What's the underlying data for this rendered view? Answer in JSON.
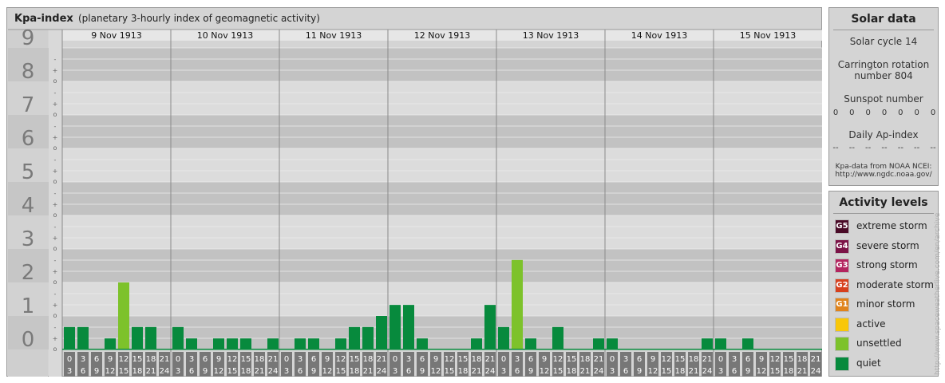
{
  "header": {
    "title": "Kpa-index",
    "subtitle": "(planetary 3-hourly index of geomagnetic activity)"
  },
  "chart_data": {
    "type": "bar",
    "title": "Kpa-index",
    "subtitle": "(planetary 3-hourly index of geomagnetic activity)",
    "ylim": [
      0,
      9
    ],
    "y_ticks": [
      "0",
      "1",
      "2",
      "3",
      "4",
      "5",
      "6",
      "7",
      "8",
      "9"
    ],
    "sub_ticks": [
      "o",
      "+",
      "-"
    ],
    "days": [
      "9 Nov 1913",
      "10 Nov 1913",
      "11 Nov 1913",
      "12 Nov 1913",
      "13 Nov 1913",
      "14 Nov 1913",
      "15 Nov 1913"
    ],
    "interval_start_hours": [
      "0",
      "3",
      "6",
      "9",
      "12",
      "15",
      "18",
      "21"
    ],
    "interval_end_hours": [
      "3",
      "6",
      "9",
      "12",
      "15",
      "18",
      "21",
      "24"
    ],
    "values": [
      0.67,
      0.67,
      0,
      0.33,
      2,
      0.67,
      0.67,
      0,
      0.67,
      0.33,
      0,
      0.33,
      0.33,
      0.33,
      0,
      0.33,
      0,
      0.33,
      0.33,
      0,
      0.33,
      0.67,
      0.67,
      1,
      1.33,
      1.33,
      0.33,
      0,
      0,
      0,
      0.33,
      1.33,
      0.67,
      2.67,
      0.33,
      0,
      0.67,
      0,
      0,
      0.33,
      0.33,
      0,
      0,
      0,
      0,
      0,
      0,
      0.33,
      0.33,
      0,
      0.33,
      0,
      0,
      0,
      0,
      0
    ],
    "colors": {
      "quiet": "#078a3d",
      "unsettled": "#7dc22b",
      "active": "#f8c70a",
      "minor": "#e0841c",
      "moderate": "#d7401e",
      "strong": "#b3255f",
      "severe": "#7c1347",
      "extreme": "#4a0b27"
    }
  },
  "solar": {
    "title": "Solar data",
    "cycle": "Solar cycle 14",
    "carrington_line1": "Carrington rotation",
    "carrington_line2": "number 804",
    "sunspot_label": "Sunspot number",
    "sunspot_values": [
      "0",
      "0",
      "0",
      "0",
      "0",
      "0",
      "0"
    ],
    "ap_label": "Daily Ap-index",
    "ap_values": [
      "--",
      "--",
      "--",
      "--",
      "--",
      "--",
      "--"
    ],
    "source_line1": "Kpa-data from NOAA NCEI:",
    "source_line2": "http://www.ngdc.noaa.gov/"
  },
  "activity": {
    "title": "Activity levels",
    "levels": [
      {
        "badge": "G5",
        "label": "extreme storm",
        "color": "#4a0b27"
      },
      {
        "badge": "G4",
        "label": "severe storm",
        "color": "#7c1347"
      },
      {
        "badge": "G3",
        "label": "strong storm",
        "color": "#b3255f"
      },
      {
        "badge": "G2",
        "label": "moderate storm",
        "color": "#d7401e"
      },
      {
        "badge": "G1",
        "label": "minor storm",
        "color": "#e0841c"
      },
      {
        "badge": "",
        "label": "active",
        "color": "#f8c70a"
      },
      {
        "badge": "",
        "label": "unsettled",
        "color": "#7dc22b"
      },
      {
        "badge": "",
        "label": "quiet",
        "color": "#078a3d"
      }
    ]
  },
  "watermark": "http://www.spaceweatherlive.com/en/archive"
}
